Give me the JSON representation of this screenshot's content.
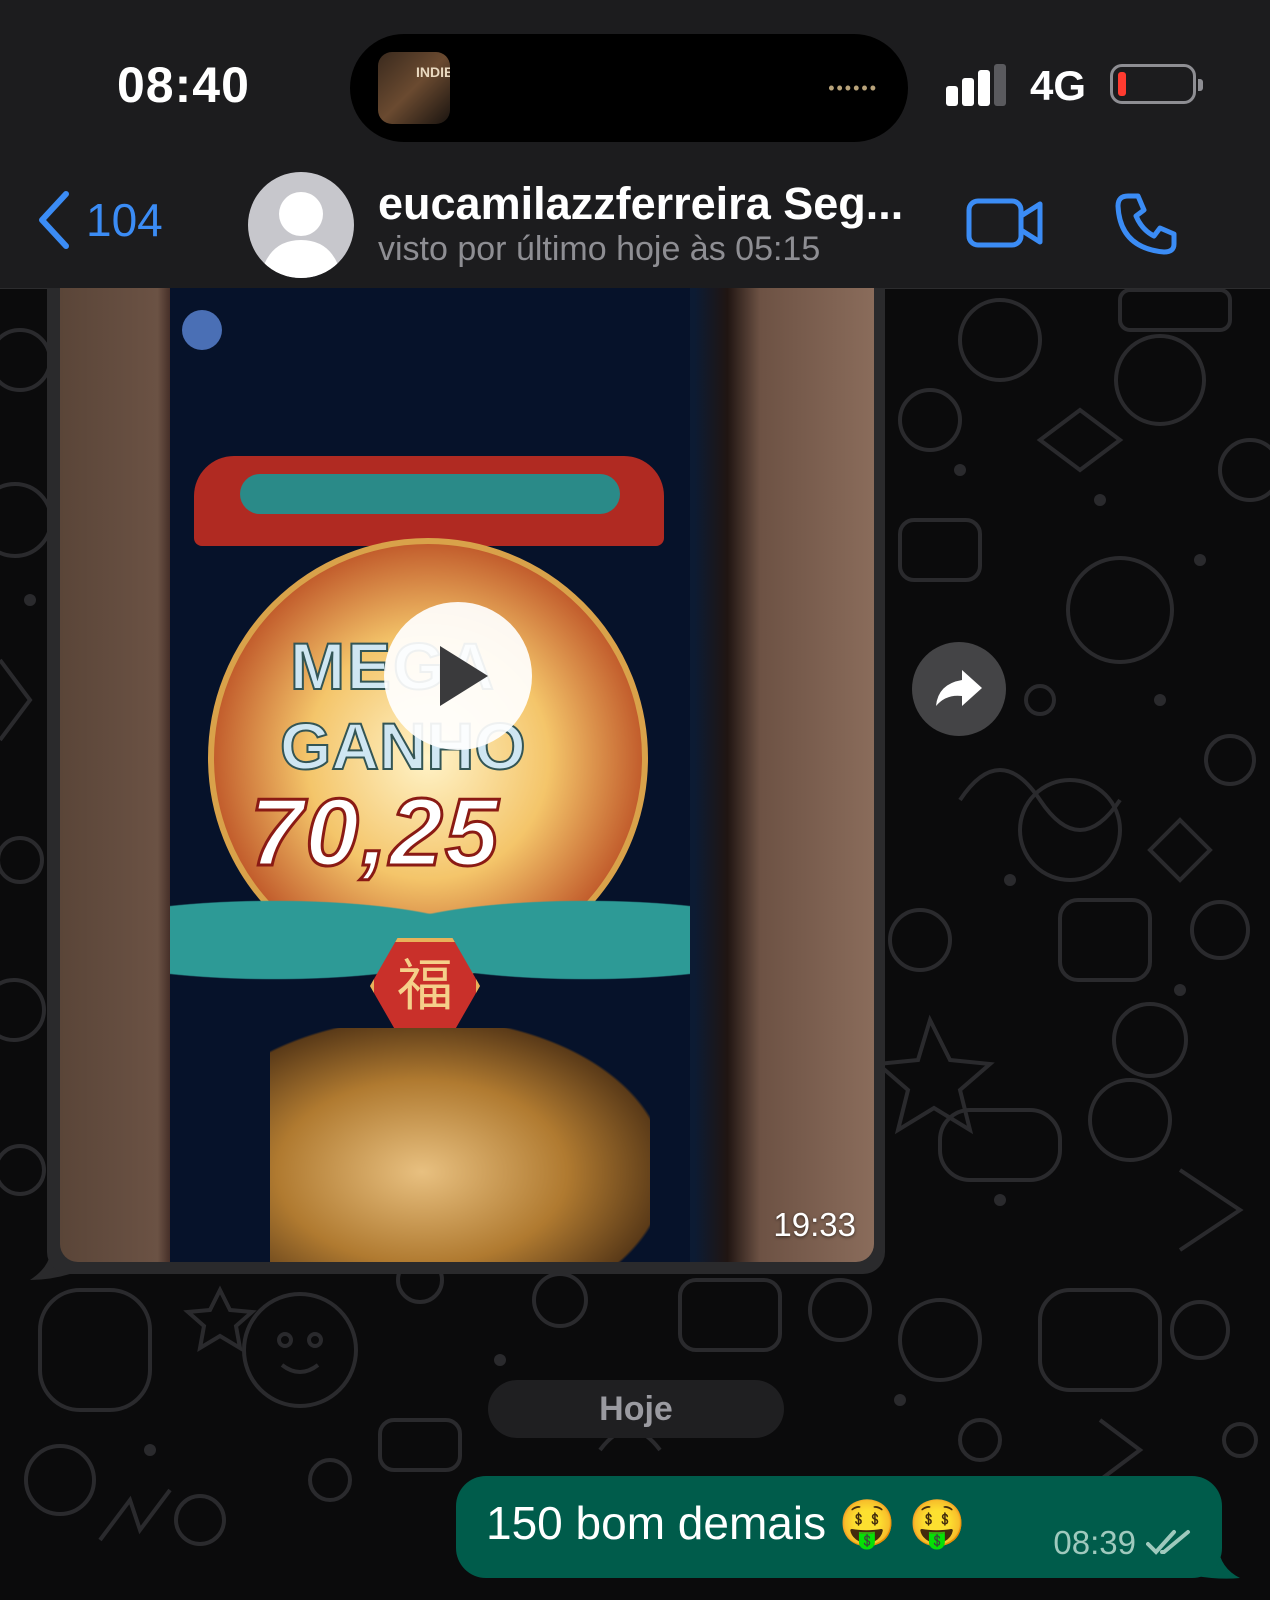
{
  "status_bar": {
    "time": "08:40",
    "network": "4G",
    "island_thumb_text": "INDIE",
    "island_dots": "••••••"
  },
  "header": {
    "back_count": "104",
    "contact_name": "eucamilazzferreira Seg...",
    "last_seen": "visto por último hoje às 05:15"
  },
  "video_message": {
    "game_text_line1": "MEGA",
    "game_text_line2": "GANHO",
    "game_amount": "70,25",
    "fu_char": "福",
    "duration": "19:33"
  },
  "date_separator": "Hoje",
  "outgoing_message": {
    "text": "150 bom demais 🤑 🤑",
    "time": "08:39",
    "status": "read"
  },
  "colors": {
    "accent_blue": "#3b8cf5",
    "outgoing_bubble": "#005c4b",
    "incoming_bubble": "#2a2a2c",
    "battery_low": "#ff3b30"
  }
}
